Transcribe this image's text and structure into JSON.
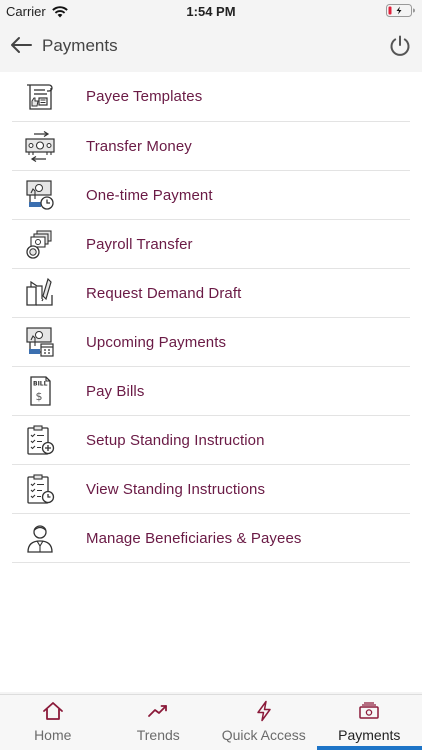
{
  "status_bar": {
    "carrier": "Carrier",
    "time": "1:54 PM"
  },
  "header": {
    "title": "Payments",
    "back_icon": "arrow-left-icon",
    "power_icon": "power-icon"
  },
  "menu": {
    "items": [
      {
        "label": "Payee Templates",
        "icon": "payee-templates-icon"
      },
      {
        "label": "Transfer Money",
        "icon": "transfer-money-icon"
      },
      {
        "label": "One-time Payment",
        "icon": "one-time-payment-icon"
      },
      {
        "label": "Payroll Transfer",
        "icon": "payroll-transfer-icon"
      },
      {
        "label": "Request Demand Draft",
        "icon": "demand-draft-icon"
      },
      {
        "label": "Upcoming Payments",
        "icon": "upcoming-payments-icon"
      },
      {
        "label": "Pay Bills",
        "icon": "bill-icon",
        "icon_text": "BILL"
      },
      {
        "label": "Setup Standing Instruction",
        "icon": "clipboard-add-icon"
      },
      {
        "label": "View Standing Instructions",
        "icon": "clipboard-clock-icon"
      },
      {
        "label": "Manage Beneficiaries & Payees",
        "icon": "person-icon"
      }
    ]
  },
  "tabbar": {
    "tabs": [
      {
        "label": "Home",
        "icon": "home-icon"
      },
      {
        "label": "Trends",
        "icon": "trend-icon"
      },
      {
        "label": "Quick Access",
        "icon": "lightning-icon"
      },
      {
        "label": "Payments",
        "icon": "payments-icon"
      }
    ],
    "active": "Payments"
  },
  "colors": {
    "label": "#6a1a45",
    "tab_active_indicator": "#1d74c7",
    "icon_accent": "#8b1a3a"
  }
}
